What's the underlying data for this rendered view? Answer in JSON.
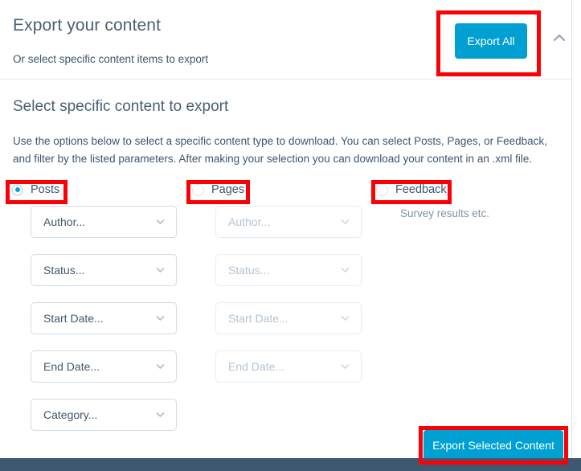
{
  "header": {
    "title": "Export your content",
    "subtitle": "Or select specific content items to export",
    "export_all_label": "Export All",
    "collapse_icon": "chevron-up-icon"
  },
  "section": {
    "title": "Select specific content to export",
    "description": "Use the options below to select a specific content type to download. You can select Posts, Pages, or Feedback, and filter by the listed parameters. After making your selection you can download your content in an .xml file."
  },
  "content_types": [
    {
      "id": "posts",
      "label": "Posts",
      "selected": true,
      "note": ""
    },
    {
      "id": "pages",
      "label": "Pages",
      "selected": false,
      "note": ""
    },
    {
      "id": "feedback",
      "label": "Feedback",
      "selected": false,
      "note": "Survey results etc."
    }
  ],
  "posts_filters": [
    {
      "label": "Author...",
      "caret": "chevron-down-icon",
      "enabled": true
    },
    {
      "label": "Status...",
      "caret": "chevron-down-icon",
      "enabled": true
    },
    {
      "label": "Start Date...",
      "caret": "chevron-down-icon",
      "enabled": true
    },
    {
      "label": "End Date...",
      "caret": "chevron-down-icon",
      "enabled": true
    },
    {
      "label": "Category...",
      "caret": "chevron-down-icon",
      "enabled": true
    }
  ],
  "pages_filters": [
    {
      "label": "Author...",
      "caret": "chevron-down-icon",
      "enabled": false
    },
    {
      "label": "Status...",
      "caret": "chevron-down-icon",
      "enabled": false
    },
    {
      "label": "Start Date...",
      "caret": "chevron-down-icon",
      "enabled": false
    },
    {
      "label": "End Date...",
      "caret": "chevron-down-icon",
      "enabled": false
    }
  ],
  "footer": {
    "export_selected_label": "Export Selected Content"
  },
  "colors": {
    "accent_blue": "#00a0d2",
    "annotation_red": "#fb0007",
    "text_slate": "#3d566e",
    "heading_slate": "#4a5f73",
    "muted": "#7d93a8",
    "bottom_bar": "#3e5871"
  }
}
